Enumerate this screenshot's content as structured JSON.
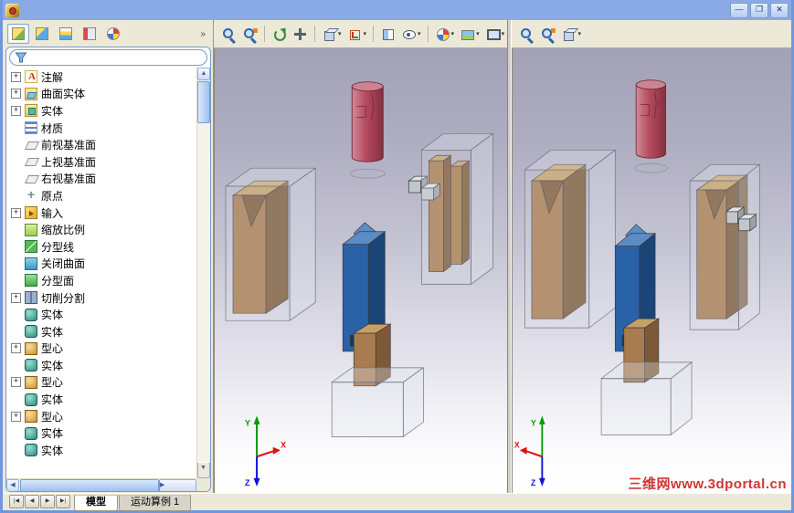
{
  "window": {
    "title": "",
    "controls": {
      "minimize": "—",
      "maximize": "❐",
      "close": "✕"
    }
  },
  "panel_toolbar": {
    "tabs": [
      {
        "name": "feature-manager-tab",
        "active": true
      },
      {
        "name": "property-manager-tab",
        "active": false
      },
      {
        "name": "configuration-manager-tab",
        "active": false
      },
      {
        "name": "dimxpert-manager-tab",
        "active": false
      },
      {
        "name": "display-manager-tab",
        "active": false
      }
    ],
    "overflow_label": "»"
  },
  "filter": {
    "value": ""
  },
  "tree": {
    "items": [
      {
        "label": "注解",
        "icon": "annotation-icon",
        "expandable": true
      },
      {
        "label": "曲面实体",
        "icon": "surface-folder-icon",
        "expandable": true
      },
      {
        "label": "实体",
        "icon": "solid-folder-icon",
        "expandable": true
      },
      {
        "label": "材质",
        "icon": "material-icon",
        "expandable": false
      },
      {
        "label": "前视基准面",
        "icon": "plane-icon",
        "expandable": false
      },
      {
        "label": "上视基准面",
        "icon": "plane-icon",
        "expandable": false
      },
      {
        "label": "右视基准面",
        "icon": "plane-icon",
        "expandable": false
      },
      {
        "label": "原点",
        "icon": "origin-icon",
        "expandable": false
      },
      {
        "label": "输入",
        "icon": "imported-icon",
        "expandable": true
      },
      {
        "label": "缩放比例",
        "icon": "scale-icon",
        "expandable": false
      },
      {
        "label": "分型线",
        "icon": "parting-line-icon",
        "expandable": false
      },
      {
        "label": "关闭曲面",
        "icon": "shutoff-surface-icon",
        "expandable": false
      },
      {
        "label": "分型面",
        "icon": "parting-surface-icon",
        "expandable": false
      },
      {
        "label": "切削分割",
        "icon": "tooling-split-icon",
        "expandable": true
      },
      {
        "label": "实体",
        "icon": "body-icon",
        "expandable": false
      },
      {
        "label": "实体",
        "icon": "body-icon",
        "expandable": false
      },
      {
        "label": "型心",
        "icon": "core-icon",
        "expandable": true
      },
      {
        "label": "实体",
        "icon": "body-icon",
        "expandable": false
      },
      {
        "label": "型心",
        "icon": "core-icon",
        "expandable": true
      },
      {
        "label": "实体",
        "icon": "body-icon",
        "expandable": false
      },
      {
        "label": "型心",
        "icon": "core-icon",
        "expandable": true
      },
      {
        "label": "实体",
        "icon": "body-icon",
        "expandable": false
      },
      {
        "label": "实体",
        "icon": "body-icon",
        "expandable": false
      }
    ]
  },
  "viewport_toolbar": {
    "left_icons": [
      {
        "name": "zoom-fit-icon",
        "caret": false,
        "sep_after": false
      },
      {
        "name": "zoom-area-icon",
        "caret": false,
        "sep_after": true
      },
      {
        "name": "rotate-view-icon",
        "caret": false,
        "sep_after": false
      },
      {
        "name": "pan-icon",
        "caret": false,
        "sep_after": true
      },
      {
        "name": "display-style-icon",
        "caret": true,
        "sep_after": false
      },
      {
        "name": "view-orientation-icon",
        "caret": true,
        "sep_after": true
      },
      {
        "name": "section-view-icon",
        "caret": false,
        "sep_after": false
      },
      {
        "name": "hide-show-items-icon",
        "caret": true,
        "sep_after": true
      },
      {
        "name": "edit-appearance-icon",
        "caret": true,
        "sep_after": false
      },
      {
        "name": "apply-scene-icon",
        "caret": true,
        "sep_after": false
      },
      {
        "name": "view-settings-icon",
        "caret": true,
        "sep_after": false
      }
    ],
    "right_icons": [
      {
        "name": "zoom-fit-icon",
        "caret": false,
        "sep_after": false
      },
      {
        "name": "zoom-area-icon",
        "caret": false,
        "sep_after": false
      },
      {
        "name": "display-style-icon",
        "caret": true,
        "sep_after": false
      }
    ],
    "caret_glyph": "▾"
  },
  "scrollbar": {
    "up": "▲",
    "down": "▼",
    "left": "◀",
    "right": "▶"
  },
  "triad": {
    "x_label": "X",
    "y_label": "Y",
    "z_label": "Z"
  },
  "bottom_bar": {
    "nav": [
      "|◀",
      "◀",
      "▶",
      "▶|"
    ],
    "tabs": [
      {
        "label": "模型",
        "active": true
      },
      {
        "label": "运动算例 1",
        "active": false
      }
    ]
  },
  "watermark": {
    "text": "三维网www.3dportal.cn"
  },
  "colors": {
    "titlebar": "#8aaae6",
    "window_border": "#7096e0",
    "toolbar_bg": "#ece9d8",
    "panel_border": "#7a9cc9",
    "viewport_top": "#a3a1b6",
    "viewport_bottom": "#ffffff",
    "model_red": "#b54a5e",
    "model_red_dark": "#853040",
    "model_red_light": "#d08a98",
    "model_red_top": "#cf8292",
    "model_brown": "#a87c4f",
    "model_brown_dark": "#7c5a38",
    "model_brown_light": "#c7a068",
    "model_blue": "#2a62a8",
    "model_blue_dark": "#1b4477",
    "model_blue_light": "#5b8cc6",
    "model_blue_slot": "#16385e",
    "ghost_fill": "#dfe4ee",
    "ghost_stroke": "#6f747e",
    "cube_gray": "#c2c7ce",
    "cube_gray_dark": "#9ba1a9",
    "cube_gray_light": "#dfe2e6",
    "watermark_red": "#cc1f1f",
    "triad_x": "#dd1111",
    "triad_y": "#00九a00",
    "triad_y_hex": "#089a08",
    "triad_z": "#1111dd"
  }
}
